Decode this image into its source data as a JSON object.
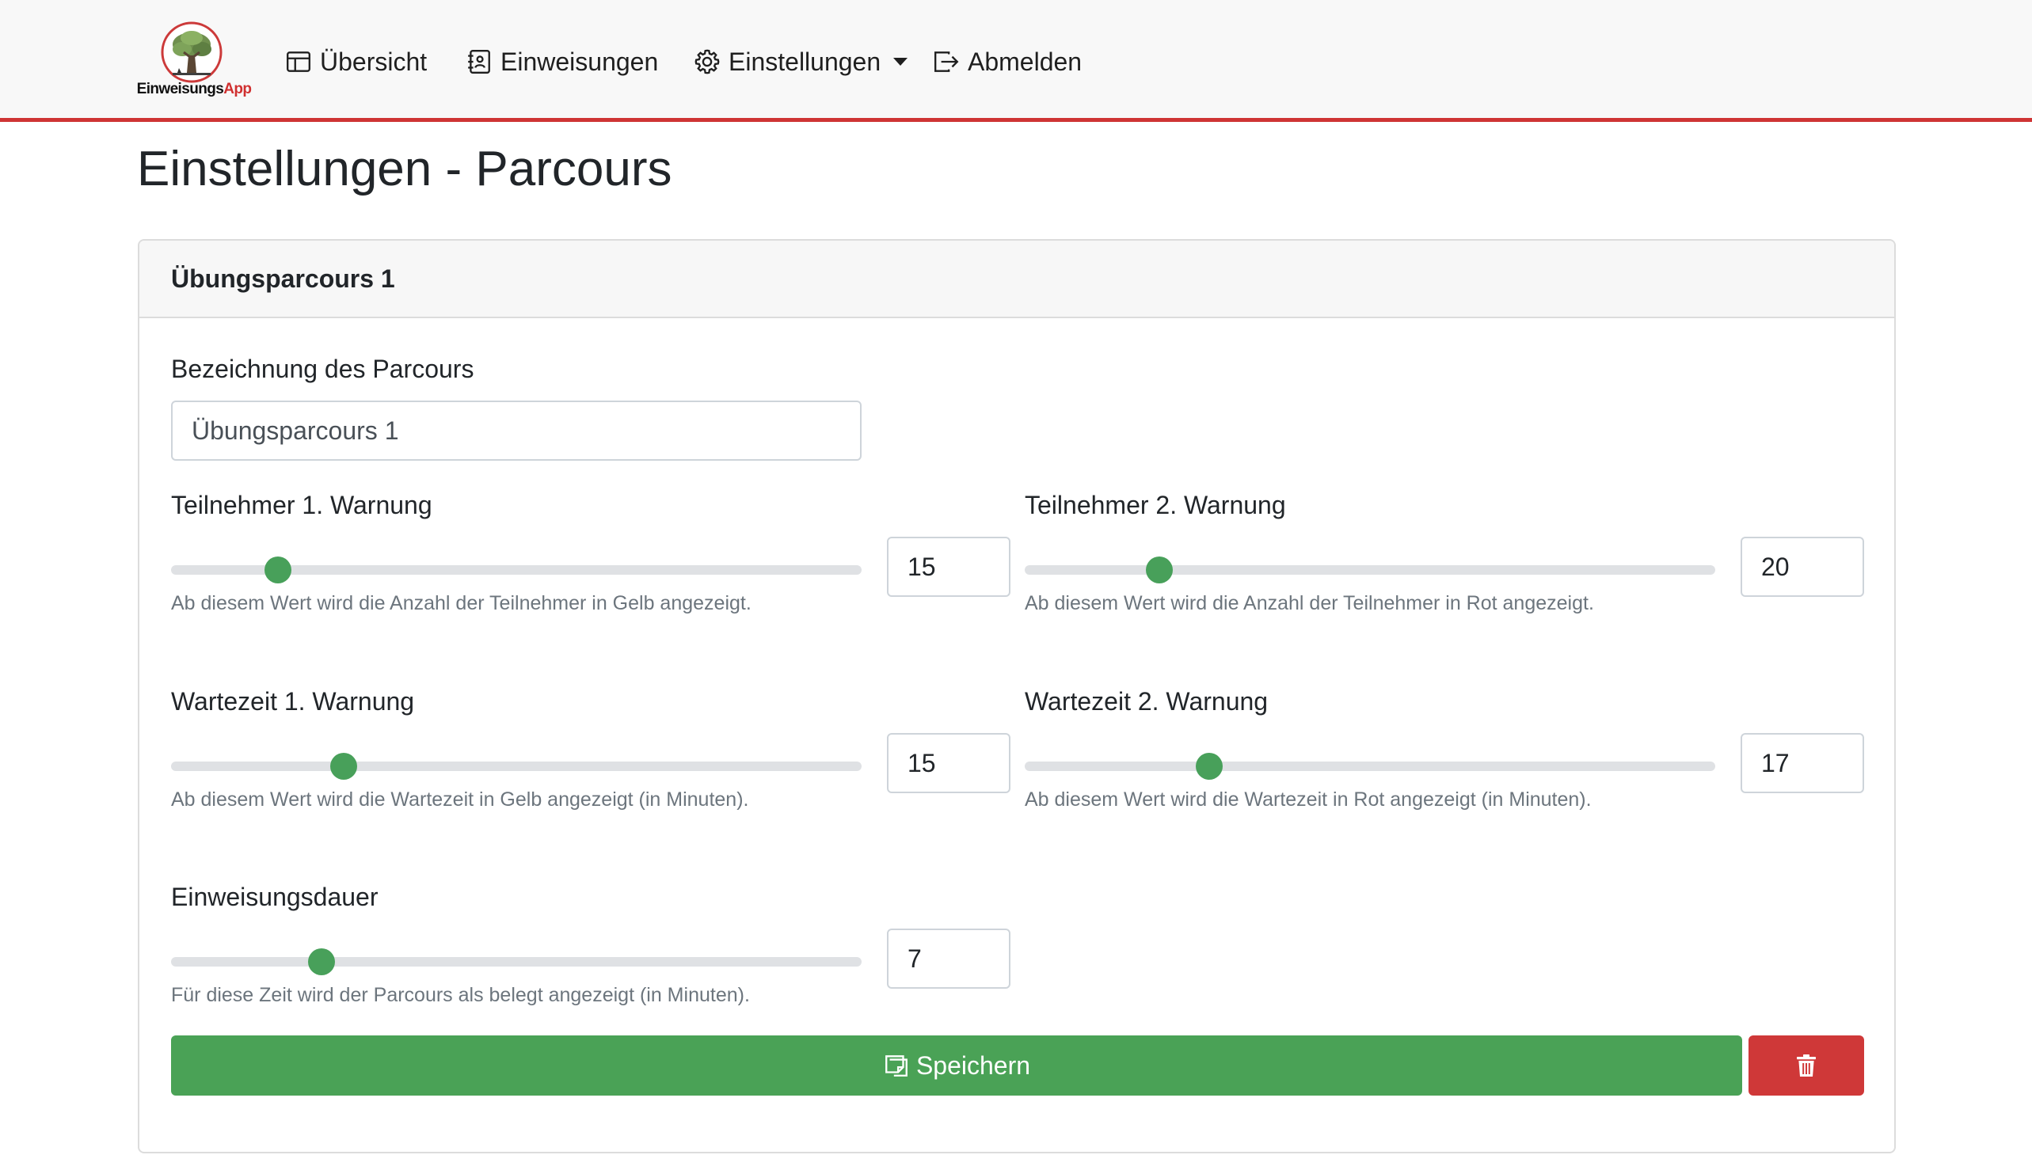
{
  "app": {
    "logo_brand_main": "Einweisungs",
    "logo_brand_accent": "App",
    "colors": {
      "accent": "#cf3434",
      "success": "#4aa256",
      "danger": "#cf3838",
      "slider_thumb": "#48a05a"
    }
  },
  "nav": {
    "items": [
      {
        "label": "Übersicht",
        "icon": "layout-icon"
      },
      {
        "label": "Einweisungen",
        "icon": "journal-icon"
      },
      {
        "label": "Einstellungen",
        "icon": "gear-icon",
        "dropdown": true
      },
      {
        "label": "Abmelden",
        "icon": "logout-icon"
      }
    ]
  },
  "page": {
    "title": "Einstellungen - Parcours"
  },
  "card": {
    "header": "Übungsparcours 1",
    "name_field": {
      "label": "Bezeichnung des Parcours",
      "value": "Übungsparcours 1"
    },
    "fields": {
      "participants_warn1": {
        "label": "Teilnehmer 1. Warnung",
        "value": "15",
        "slider_fraction": 0.155,
        "help": "Ab diesem Wert wird die Anzahl der Teilnehmer in Gelb angezeigt."
      },
      "participants_warn2": {
        "label": "Teilnehmer 2. Warnung",
        "value": "20",
        "slider_fraction": 0.195,
        "help": "Ab diesem Wert wird die Anzahl der Teilnehmer in Rot angezeigt."
      },
      "wait_warn1": {
        "label": "Wartezeit 1. Warnung",
        "value": "15",
        "slider_fraction": 0.25,
        "help": "Ab diesem Wert wird die Wartezeit in Gelb angezeigt (in Minuten)."
      },
      "wait_warn2": {
        "label": "Wartezeit 2. Warnung",
        "value": "17",
        "slider_fraction": 0.267,
        "help": "Ab diesem Wert wird die Wartezeit in Rot angezeigt (in Minuten)."
      },
      "briefing_duration": {
        "label": "Einweisungsdauer",
        "value": "7",
        "slider_fraction": 0.218,
        "help": "Für diese Zeit wird der Parcours als belegt angezeigt (in Minuten)."
      }
    },
    "save_label": "Speichern",
    "save_icon": "save-icon",
    "delete_icon": "trash-icon"
  }
}
